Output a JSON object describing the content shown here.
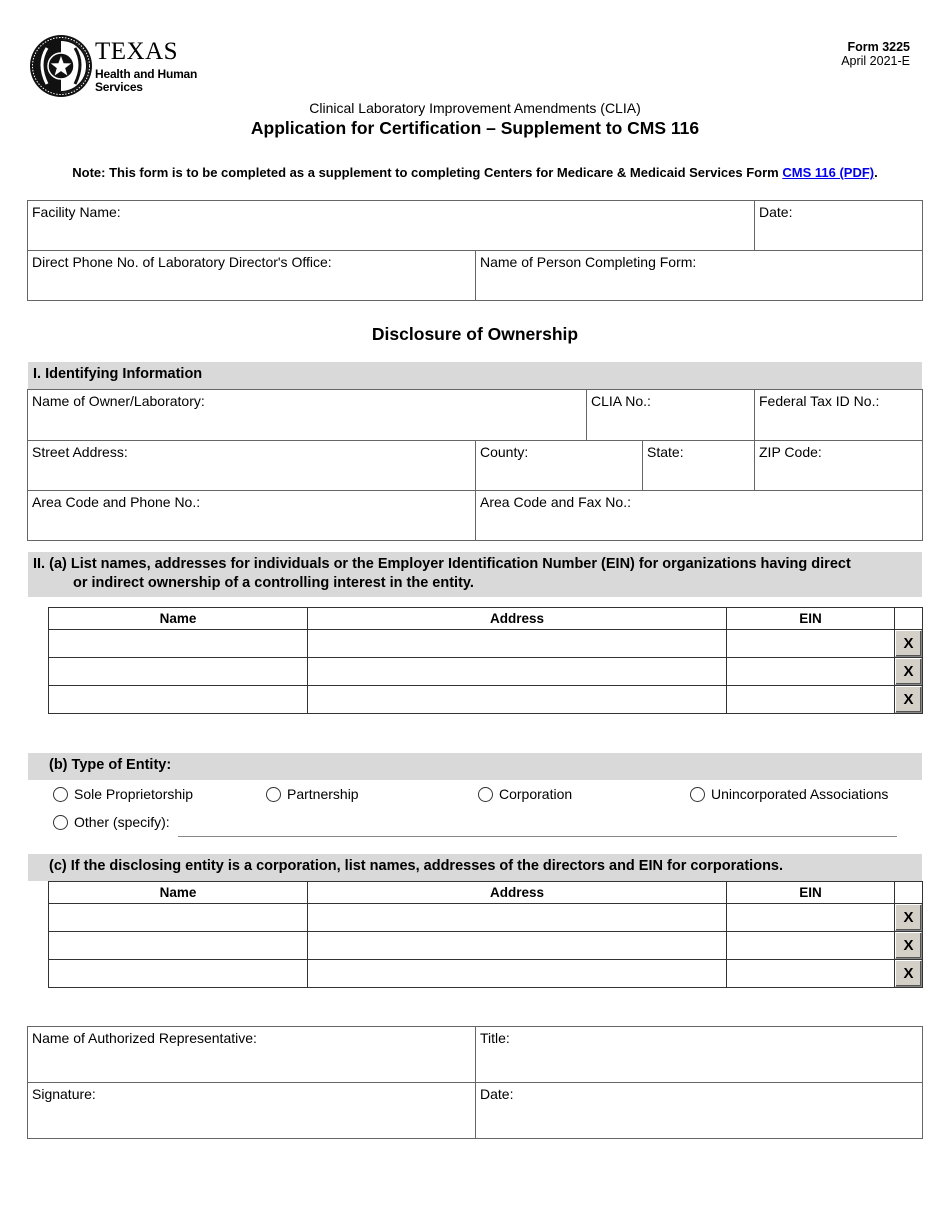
{
  "header": {
    "logo": {
      "icon": "texas-seal-star-icon",
      "line1": "TEXAS",
      "line2": "Health and Human",
      "line3": "Services"
    },
    "form_number": "Form 3225",
    "form_date": "April 2021-E",
    "subtitle": "Clinical Laboratory Improvement Amendments (CLIA)",
    "title": "Application for Certification – Supplement to CMS 116"
  },
  "note": {
    "text": "Note: This form is to be completed as a supplement to completing Centers for Medicare & Medicaid Services Form ",
    "link_text": "CMS 116 (PDF)",
    "suffix": ".",
    "link_color": "#0000ee"
  },
  "facility_block": {
    "facility_name": {
      "label": "Facility Name:",
      "value": ""
    },
    "date": {
      "label": "Date:",
      "value": ""
    },
    "director_phone": {
      "label": "Direct Phone No. of Laboratory Director's Office:",
      "value": ""
    },
    "person_completing": {
      "label": "Name of Person Completing Form:",
      "value": ""
    }
  },
  "section_title": "Disclosure of Ownership",
  "identifying": {
    "heading": "I. Identifying Information",
    "owner_name": {
      "label": "Name of Owner/Laboratory:",
      "value": ""
    },
    "clia_no": {
      "label": "CLIA No.:",
      "value": ""
    },
    "federal_tax_id": {
      "label": "Federal Tax ID No.:",
      "value": ""
    },
    "street_address": {
      "label": "Street Address:",
      "value": ""
    },
    "county": {
      "label": "County:",
      "value": ""
    },
    "state": {
      "label": "State:",
      "value": ""
    },
    "zip": {
      "label": "ZIP Code:",
      "value": ""
    },
    "phone": {
      "label": "Area Code and Phone No.:",
      "value": ""
    },
    "fax": {
      "label": "Area Code and Fax No.:",
      "value": ""
    }
  },
  "ownership": {
    "heading_line1": "II. (a) List names, addresses for individuals or the Employer Identification Number (EIN) for organizations having direct",
    "heading_line2": "or indirect ownership of a controlling interest in the entity.",
    "columns": [
      "Name",
      "Address",
      "EIN"
    ],
    "rows": [
      {
        "name": "",
        "address": "",
        "ein": "",
        "delete_label": "X"
      },
      {
        "name": "",
        "address": "",
        "ein": "",
        "delete_label": "X"
      },
      {
        "name": "",
        "address": "",
        "ein": "",
        "delete_label": "X"
      }
    ]
  },
  "entity_type": {
    "heading": "(b) Type of Entity:",
    "options": [
      "Sole Proprietorship",
      "Partnership",
      "Corporation",
      "Unincorporated Associations",
      "Other (specify):"
    ],
    "selected": null,
    "other_value": ""
  },
  "directors": {
    "heading": "(c) If the disclosing entity is a corporation, list names, addresses of the directors and EIN for corporations.",
    "columns": [
      "Name",
      "Address",
      "EIN"
    ],
    "rows": [
      {
        "name": "",
        "address": "",
        "ein": "",
        "delete_label": "X"
      },
      {
        "name": "",
        "address": "",
        "ein": "",
        "delete_label": "X"
      },
      {
        "name": "",
        "address": "",
        "ein": "",
        "delete_label": "X"
      }
    ]
  },
  "signature_block": {
    "authorized_rep": {
      "label": "Name of Authorized Representative:",
      "value": ""
    },
    "title": {
      "label": "Title:",
      "value": ""
    },
    "signature": {
      "label": "Signature:",
      "value": ""
    },
    "date": {
      "label": "Date:",
      "value": ""
    }
  }
}
